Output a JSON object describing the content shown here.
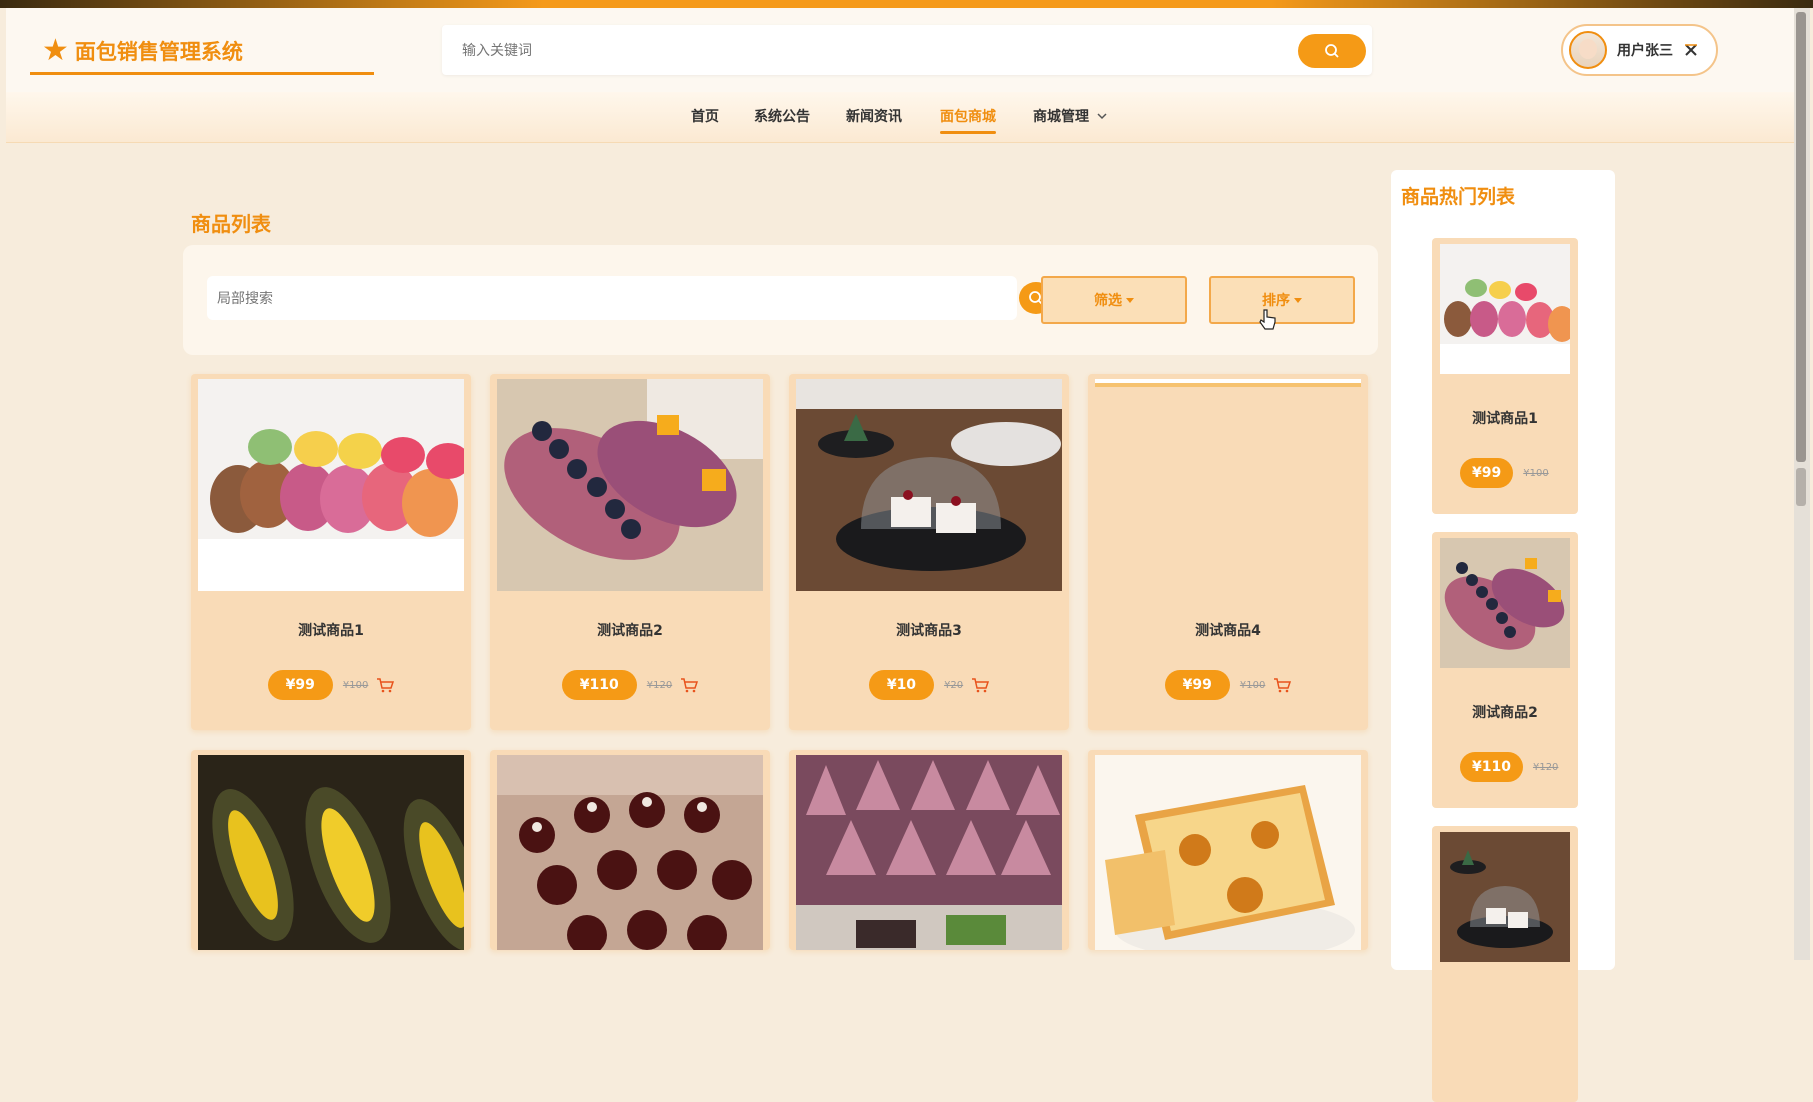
{
  "brand": {
    "title": "面包销售管理系统",
    "icon": "star-icon"
  },
  "top_search": {
    "placeholder": "输入关键词",
    "icon": "search-icon"
  },
  "user": {
    "name": "用户张三",
    "icon": "close-icon"
  },
  "nav": {
    "items": [
      {
        "label": "首页"
      },
      {
        "label": "系统公告"
      },
      {
        "label": "新闻资讯"
      },
      {
        "label": "面包商城",
        "active": true
      },
      {
        "label": "商城管理",
        "dropdown": true
      }
    ]
  },
  "section_title": "商品列表",
  "local_search": {
    "placeholder": "局部搜索"
  },
  "filter": {
    "label": "筛选"
  },
  "sort": {
    "label": "排序"
  },
  "products": [
    {
      "name": "测试商品1",
      "price": "¥99",
      "old_price": "¥100",
      "image": "macaron"
    },
    {
      "name": "测试商品2",
      "price": "¥110",
      "old_price": "¥120",
      "image": "blueberry-roll"
    },
    {
      "name": "测试商品3",
      "price": "¥10",
      "old_price": "¥20",
      "image": "cake-dome"
    },
    {
      "name": "测试商品4",
      "price": "¥99",
      "old_price": "¥100",
      "image": "blank"
    },
    {
      "image": "durian-bread"
    },
    {
      "image": "chocolate-canele"
    },
    {
      "image": "pink-cones"
    },
    {
      "image": "toast"
    }
  ],
  "hot": {
    "title": "商品热门列表",
    "items": [
      {
        "name": "测试商品1",
        "price": "¥99",
        "old_price": "¥100",
        "image": "macaron"
      },
      {
        "name": "测试商品2",
        "price": "¥110",
        "old_price": "¥120",
        "image": "blueberry-roll"
      },
      {
        "image": "cake-dome"
      }
    ]
  },
  "colors": {
    "accent": "#f08e10",
    "card": "#f9dbb7",
    "background": "#f7ecdc"
  }
}
